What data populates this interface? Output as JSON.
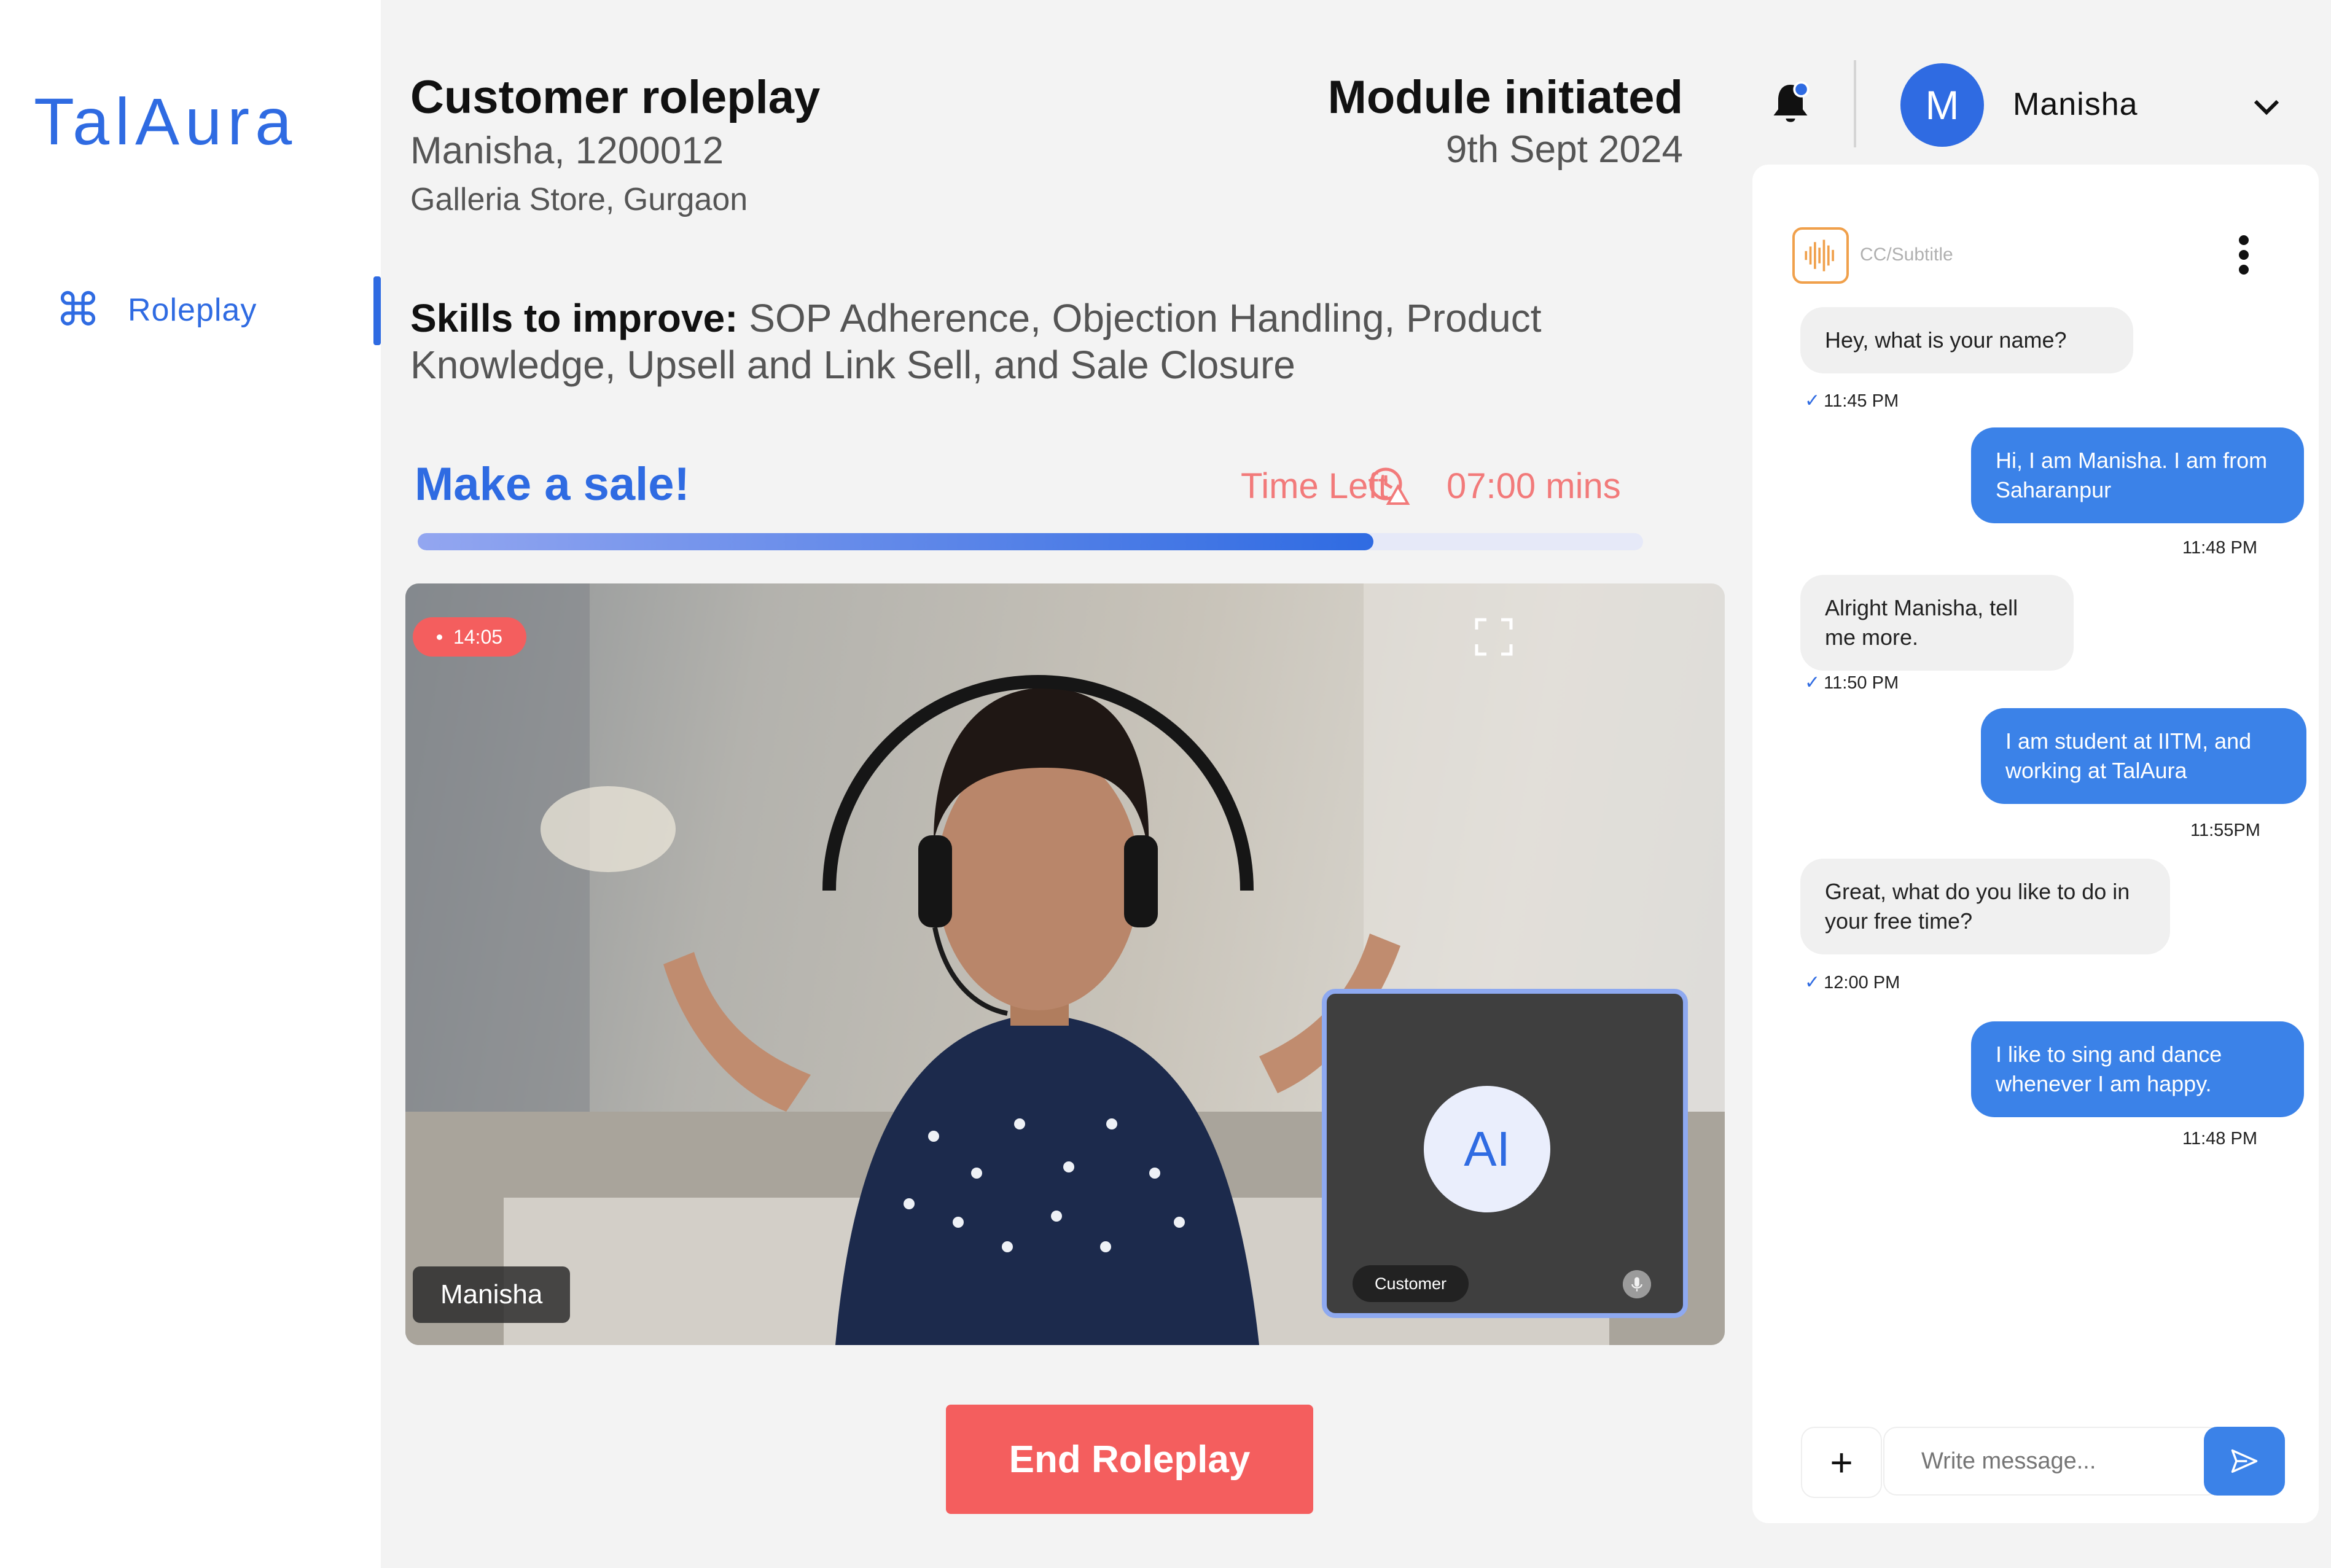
{
  "brand": {
    "name": "TalAura"
  },
  "sidebar": {
    "items": [
      {
        "label": "Roleplay",
        "icon": "command-icon",
        "active": true
      }
    ]
  },
  "header": {
    "title": "Customer roleplay",
    "learner": "Manisha, 1200012",
    "store": "Galleria Store, Gurgaon",
    "module_status": "Module initiated",
    "module_date": "9th Sept 2024"
  },
  "skills": {
    "label": "Skills to improve:",
    "value": "SOP Adherence, Objection Handling, Product Knowledge, Upsell and Link Sell, and Sale Closure"
  },
  "task": {
    "goal": "Make a sale!",
    "time_label": "Time Left",
    "time_value": "07:00 mins",
    "progress_fraction": 0.78
  },
  "video": {
    "recording_time": "14:05",
    "participant_name": "Manisha",
    "ai_avatar_text": "AI",
    "ai_label": "Customer"
  },
  "actions": {
    "end_label": "End Roleplay"
  },
  "user": {
    "initial": "M",
    "name": "Manisha"
  },
  "chat": {
    "cc_label": "CC/Subtitle",
    "messages": [
      {
        "from": "ai",
        "text": "Hey, what is your name?",
        "time": "11:45 PM"
      },
      {
        "from": "user",
        "text": "Hi, I am Manisha. I am from Saharanpur",
        "time": "11:48 PM"
      },
      {
        "from": "ai",
        "text": "Alright Manisha, tell me more.",
        "time": "11:50 PM"
      },
      {
        "from": "user",
        "text": "I am student at IITM, and working at TalAura",
        "time": "11:55PM"
      },
      {
        "from": "ai",
        "text": "Great, what do you like to do in your free time?",
        "time": "12:00 PM"
      },
      {
        "from": "user",
        "text": "I like to sing and dance whenever I am happy.",
        "time": "11:48 PM"
      }
    ],
    "composer_placeholder": "Write message..."
  },
  "colors": {
    "accent": "#2f6be2",
    "danger": "#f45e5e",
    "user_bubble": "#3b82e8",
    "warning": "#f27a7a"
  }
}
